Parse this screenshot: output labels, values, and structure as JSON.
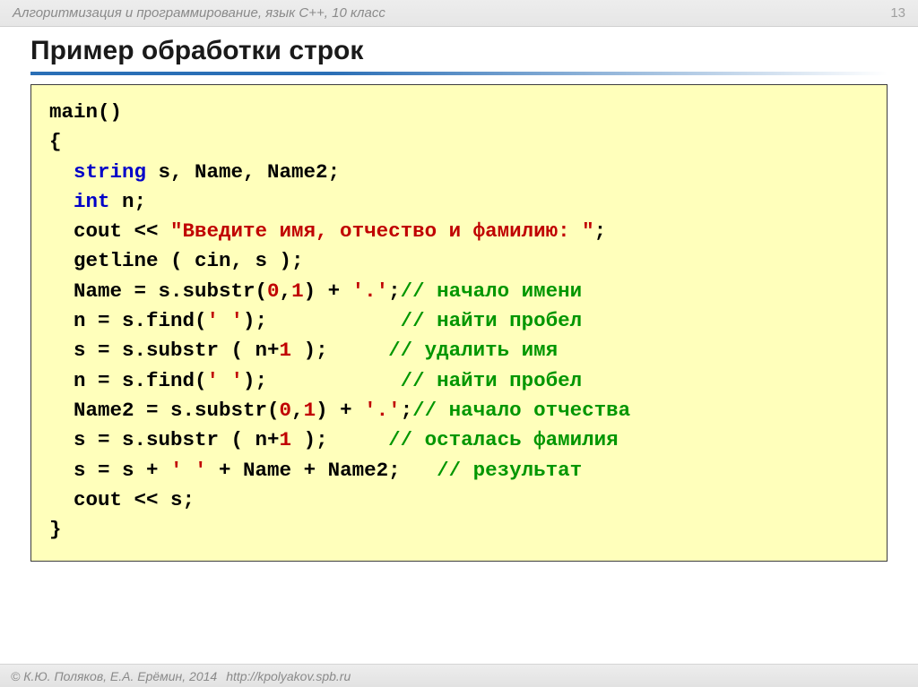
{
  "header": {
    "subtitle": "Алгоритмизация и программирование, язык C++, 10 класс",
    "pagenum": "13"
  },
  "title": "Пример обработки строк",
  "code": {
    "l01": "main()",
    "l02": "{",
    "kw_string": "string",
    "l03_rest": " s, Name, Name2;",
    "kw_int": "int",
    "l04_rest": " n;",
    "l05_a": "  cout << ",
    "l05_str": "\"Введите имя, отчество и фамилию: \"",
    "l05_b": ";",
    "l06": "  getline ( cin, s );",
    "l07_a": "  Name = s.substr(",
    "l07_n0": "0",
    "l07_b": ",",
    "l07_n1": "1",
    "l07_c": ") + ",
    "l07_ch": "'.'",
    "l07_d": ";",
    "l07_cmt": "// начало имени",
    "l08_a": "  n = s.find(",
    "l08_ch": "' '",
    "l08_b": ");           ",
    "l08_cmt": "// найти пробел",
    "l09_a": "  s = s.substr ( n+",
    "l09_n": "1",
    "l09_b": " );     ",
    "l09_cmt": "// удалить имя",
    "l10_a": "  n = s.find(",
    "l10_ch": "' '",
    "l10_b": ");           ",
    "l10_cmt": "// найти пробел",
    "l11_a": "  Name2 = s.substr(",
    "l11_n0": "0",
    "l11_b": ",",
    "l11_n1": "1",
    "l11_c": ") + ",
    "l11_ch": "'.'",
    "l11_d": ";",
    "l11_cmt": "// начало отчества",
    "l12_a": "  s = s.substr ( n+",
    "l12_n": "1",
    "l12_b": " );     ",
    "l12_cmt": "// осталась фамилия",
    "l13_a": "  s = s + ",
    "l13_ch": "' '",
    "l13_b": " + Name + Name2;   ",
    "l13_cmt": "// результат",
    "l14": "  cout << s;",
    "l15": "}"
  },
  "footer": {
    "copyright": "© К.Ю. Поляков, Е.А. Ерёмин, 2014",
    "url": "http://kpolyakov.spb.ru"
  }
}
